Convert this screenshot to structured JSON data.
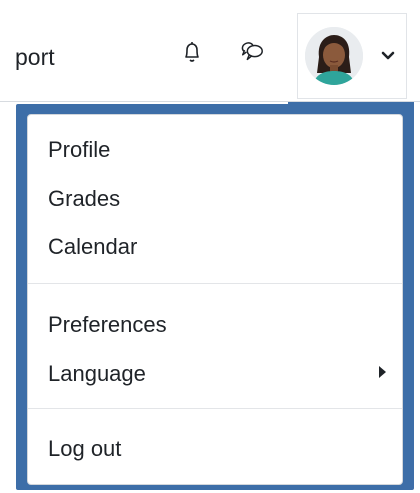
{
  "navbar": {
    "partial_link": "port",
    "notifications_icon": "bell-icon",
    "messages_icon": "chat-bubbles-icon",
    "user_menu_caret_icon": "chevron-down-icon"
  },
  "user_menu": {
    "items": [
      {
        "label": "Profile"
      },
      {
        "label": "Grades"
      },
      {
        "label": "Calendar"
      },
      {
        "label": "Preferences"
      },
      {
        "label": "Language",
        "submenu_icon": "caret-right-icon"
      },
      {
        "label": "Log out"
      }
    ]
  },
  "colors": {
    "highlight_frame": "#3d6ea8",
    "text": "#1f2328",
    "divider": "#e3e5e8"
  }
}
